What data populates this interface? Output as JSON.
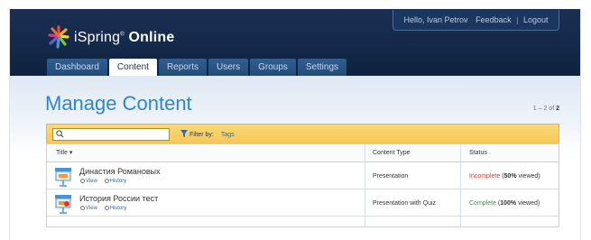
{
  "brand": {
    "name_prefix": "iSpring",
    "name_suffix": "Online",
    "trademark": "®"
  },
  "userbar": {
    "greeting": "Hello, Ivan Petrov",
    "feedback": "Feedback",
    "separator": "|",
    "logout": "Logout"
  },
  "tabs": [
    {
      "label": "Dashboard",
      "active": false
    },
    {
      "label": "Content",
      "active": true
    },
    {
      "label": "Reports",
      "active": false
    },
    {
      "label": "Users",
      "active": false
    },
    {
      "label": "Groups",
      "active": false
    },
    {
      "label": "Settings",
      "active": false
    }
  ],
  "page": {
    "title": "Manage Content"
  },
  "pagination": {
    "range": "1 – 2 of",
    "total": "2"
  },
  "filter": {
    "label": "Filter by:",
    "option": "Tags",
    "search_value": "",
    "search_placeholder": ""
  },
  "table": {
    "columns": {
      "title": "Title ▾",
      "type": "Content Type",
      "status": "Status"
    },
    "rows": [
      {
        "name": "Династия Романовых",
        "view": "View",
        "history": "History",
        "type": "Presentation",
        "status_word": "Incomplete",
        "status_open": " (",
        "status_percent": "50%",
        "status_tail": " viewed)"
      },
      {
        "name": "История России тест",
        "view": "View",
        "history": "History",
        "type": "Presentation with Quiz",
        "status_word": "Complete",
        "status_open": " (",
        "status_percent": "100%",
        "status_tail": " viewed)"
      }
    ]
  },
  "colors": {
    "header": "#14284a",
    "accent": "#2e86c9",
    "incomplete": "#d23b2a",
    "complete": "#2f9a3c"
  },
  "icons": [
    "ispring-logo-icon",
    "search-icon",
    "funnel-icon",
    "presentation-icon",
    "view-icon",
    "history-icon"
  ]
}
